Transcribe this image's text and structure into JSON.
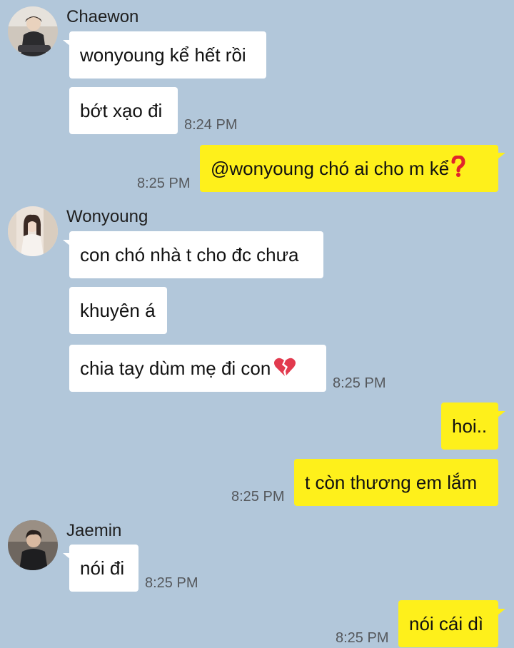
{
  "chat": {
    "groups": [
      {
        "sender": "Chaewon",
        "messages": [
          {
            "text": "wonyoung kể hết rồi"
          },
          {
            "text": "bớt xạo đi",
            "time": "8:24 PM"
          }
        ]
      },
      {
        "outgoing": true,
        "messages": [
          {
            "text": "@wonyoung chó ai cho m kể",
            "emoji": "❓",
            "time": "8:25 PM"
          }
        ]
      },
      {
        "sender": "Wonyoung",
        "messages": [
          {
            "text": "con chó nhà t cho đc chưa"
          },
          {
            "text": "khuyên á"
          },
          {
            "text": "chia tay dùm mẹ đi con",
            "emoji": "💔",
            "time": "8:25 PM"
          }
        ]
      },
      {
        "outgoing": true,
        "messages": [
          {
            "text": "hoi.."
          },
          {
            "text": "t còn thương em lắm",
            "time": "8:25 PM"
          }
        ]
      },
      {
        "sender": "Jaemin",
        "messages": [
          {
            "text": "nói đi",
            "time": "8:25 PM"
          }
        ]
      },
      {
        "outgoing": true,
        "messages": [
          {
            "text": "nói cái dì",
            "time": "8:25 PM"
          }
        ]
      }
    ]
  },
  "colors": {
    "background": "#b2c7da",
    "incoming_bubble": "#ffffff",
    "outgoing_bubble": "#fef01b",
    "timestamp": "#55585c"
  }
}
